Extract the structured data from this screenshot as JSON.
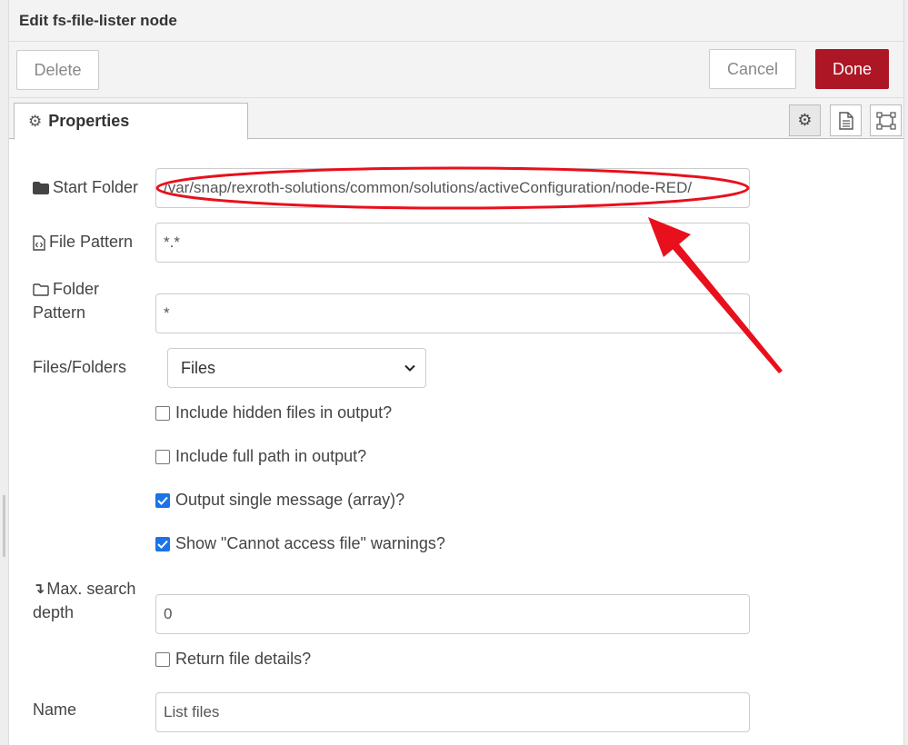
{
  "dialog": {
    "title": "Edit fs-file-lister node"
  },
  "toolbar": {
    "delete_label": "Delete",
    "cancel_label": "Cancel",
    "done_label": "Done"
  },
  "tabs": {
    "properties_label": "Properties",
    "icons": [
      "gear-icon",
      "description-icon",
      "appearance-icon"
    ]
  },
  "form": {
    "start_folder": {
      "label": "Start Folder",
      "value": "/var/snap/rexroth-solutions/common/solutions/activeConfiguration/node-RED/"
    },
    "file_pattern": {
      "label": "File Pattern",
      "value": "*.*"
    },
    "folder_pattern": {
      "label_line1": "Folder",
      "label_line2": "Pattern",
      "value": "*"
    },
    "files_folders": {
      "label": "Files/Folders",
      "selected": "Files"
    },
    "include_hidden": {
      "label": "Include hidden files in output?",
      "checked": false
    },
    "include_full_path": {
      "label": "Include full path in output?",
      "checked": false
    },
    "output_single": {
      "label": "Output single message (array)?",
      "checked": true
    },
    "show_warnings": {
      "label": "Show \"Cannot access file\" warnings?",
      "checked": true
    },
    "max_depth": {
      "label_line1": "Max. search",
      "label_line2": "depth",
      "value": "0"
    },
    "return_details": {
      "label": "Return file details?",
      "checked": false
    },
    "name": {
      "label": "Name",
      "value": "List files"
    }
  },
  "colors": {
    "done_button": "#ad1625",
    "checkbox_checked": "#1a73e8",
    "annotation": "#e8101c"
  }
}
